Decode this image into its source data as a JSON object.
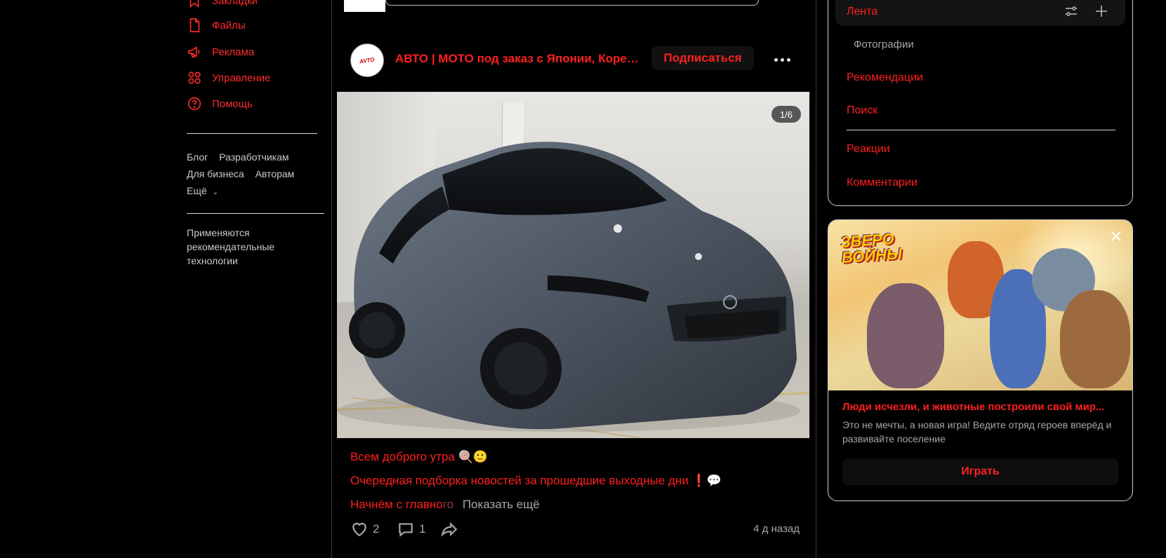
{
  "leftnav": {
    "items": [
      {
        "label": "Закладки",
        "icon": "bookmark-icon"
      },
      {
        "label": "Файлы",
        "icon": "file-icon"
      },
      {
        "label": "Реклама",
        "icon": "megaphone-icon"
      },
      {
        "label": "Управление",
        "icon": "grid-icon"
      },
      {
        "label": "Помощь",
        "icon": "help-icon"
      }
    ],
    "footer": {
      "blog": "Блог",
      "developers": "Разработчикам",
      "business": "Для бизнеса",
      "authors": "Авторам",
      "more": "Ещё"
    },
    "reco_note": "Применяются рекомендательные технологии"
  },
  "post": {
    "group_name": "АВТО | МОТО под заказ с Японии, Кореи ...",
    "subscribe_label": "Подписаться",
    "photo_counter": "1/6",
    "line1": "Всем доброго утра 🍭🙂",
    "line2": "Очередная подборка новостей за прошедшие выходные дни ❗💬",
    "line3": "Начнём с главно",
    "line3_fade": "го",
    "show_more": "Показать ещё",
    "likes": "2",
    "comments": "1",
    "time": "4 д назад",
    "avatar_text": "AVTO"
  },
  "rpanel": {
    "feed_label": "Лента",
    "photos": "Фотографии",
    "recommendations": "Рекомендации",
    "search": "Поиск",
    "reactions": "Реакции",
    "comments": "Комментарии"
  },
  "ad": {
    "logo_line1": "ЗВЕРО",
    "logo_line2": "ВОЙНЫ",
    "title": "Люди исчезли, и животные построили свой мир...",
    "description": "Это не мечты, а новая игра! Ведите отряд героев вперёд и развивайте поселение",
    "button": "Играть"
  },
  "colors": {
    "accent": "#ff1f1f",
    "muted": "#a5a7aa",
    "background": "#000000"
  }
}
